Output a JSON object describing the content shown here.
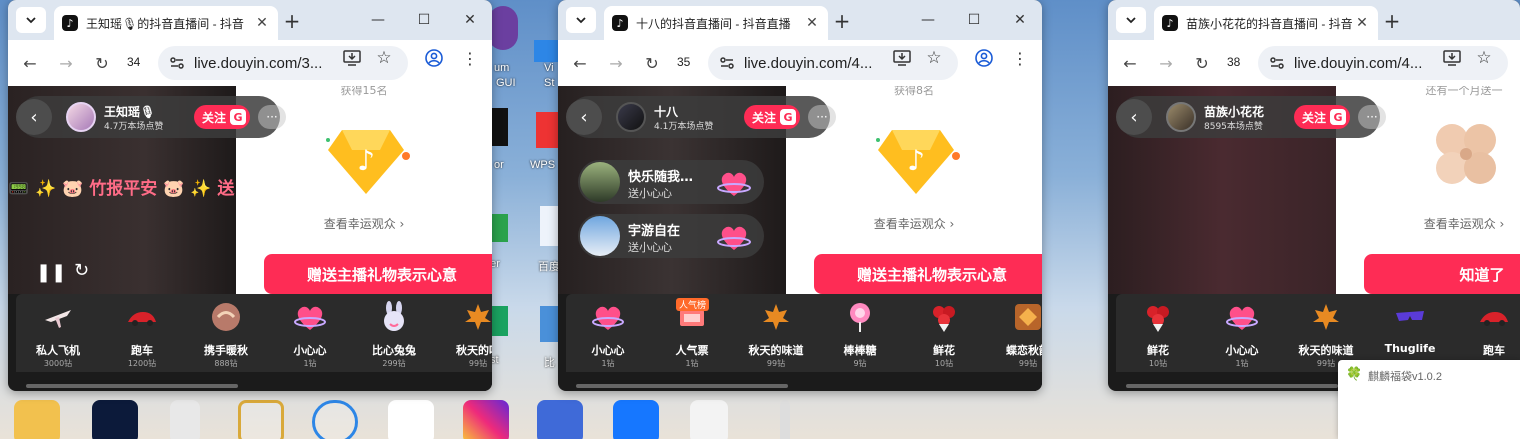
{
  "desktop": {
    "partial_labels": [
      "um",
      "GUI",
      "Vi",
      "St",
      "or",
      "WPS",
      "ner",
      "百度",
      "st",
      "比",
      "6"
    ]
  },
  "windows": [
    {
      "tab_title": "王知瑶🎙的抖音直播间 - 抖音",
      "tab_count": "34",
      "url": "live.douyin.com/3...",
      "anchor_name": "王知瑶🎙",
      "anchor_likes": "4.7万本场点赞",
      "follow_label": "关注",
      "follow_badge": "G",
      "more_label": "···",
      "top_faded": "获得15名",
      "lucky_link": "查看幸运观众 ›",
      "cta_label": "赠送主播礼物表示心意",
      "danmaku": "📟 ✨ 🐷 竹报平安 🐷 ✨ 送",
      "gifts": [
        {
          "name": "私人飞机",
          "price": "3000钻"
        },
        {
          "name": "跑车",
          "price": "1200钻"
        },
        {
          "name": "携手暖秋",
          "price": "888钻"
        },
        {
          "name": "小心心",
          "price": "1钻"
        },
        {
          "name": "比心兔兔",
          "price": "299钻"
        },
        {
          "name": "秋天的味",
          "price": "99钻"
        }
      ]
    },
    {
      "tab_title": "十八的抖音直播间 - 抖音直播",
      "tab_count": "35",
      "url": "live.douyin.com/4...",
      "anchor_name": "十八",
      "anchor_likes": "4.1万本场点赞",
      "follow_label": "关注",
      "follow_badge": "G",
      "more_label": "···",
      "top_faded": "获得8名",
      "lucky_link": "查看幸运观众 ›",
      "cta_label": "赠送主播礼物表示心意",
      "bubbles": [
        {
          "name": "快乐随我…",
          "action": "送小心心",
          "mult": "x"
        },
        {
          "name": "宇游自在",
          "action": "送小心心",
          "mult": "x"
        }
      ],
      "gift_tag": "人气榜",
      "gifts": [
        {
          "name": "小心心",
          "price": "1钻"
        },
        {
          "name": "人气票",
          "price": "1钻"
        },
        {
          "name": "秋天的味道",
          "price": "99钻"
        },
        {
          "name": "棒棒糖",
          "price": "9钻"
        },
        {
          "name": "鲜花",
          "price": "10钻"
        },
        {
          "name": "蝶恋秋韵",
          "price": "99钻"
        }
      ]
    },
    {
      "tab_title": "苗族小花花的抖音直播间 - 抖音",
      "tab_count": "38",
      "url": "live.douyin.com/4...",
      "anchor_name": "苗族小花花",
      "anchor_likes": "8595本场点赞",
      "follow_label": "关注",
      "follow_badge": "G",
      "more_label": "···",
      "top_faded": "还有一个月送一",
      "lucky_link": "查看幸运观众 ›",
      "cta_label": "知道了",
      "gifts": [
        {
          "name": "鲜花",
          "price": "10钻"
        },
        {
          "name": "小心心",
          "price": "1钻"
        },
        {
          "name": "秋天的味道",
          "price": "99钻"
        },
        {
          "name": "Thuglife",
          "price": ""
        },
        {
          "name": "跑车",
          "price": ""
        }
      ]
    }
  ],
  "popup": {
    "title": "麒麟福袋v1.0.2"
  },
  "colors": {
    "accent": "#fe2c55",
    "tabbar": "#dee6f0"
  }
}
